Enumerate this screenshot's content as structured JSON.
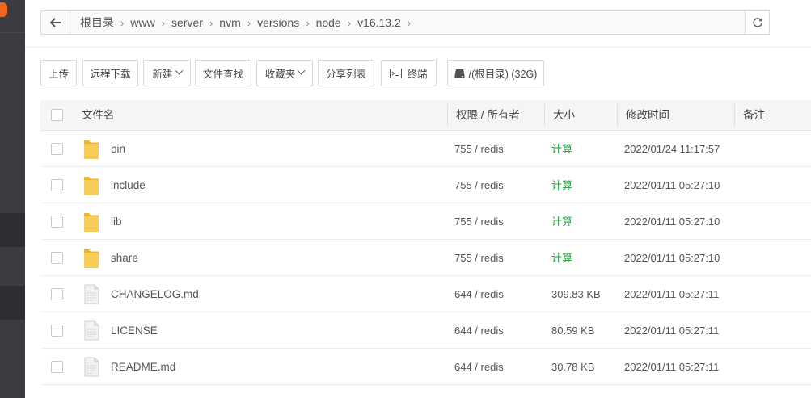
{
  "path_bar": {
    "crumbs": [
      "根目录",
      "www",
      "server",
      "nvm",
      "versions",
      "node",
      "v16.13.2"
    ]
  },
  "toolbar": {
    "upload": "上传",
    "remote_download": "远程下载",
    "new": "新建",
    "file_search": "文件查找",
    "favorites": "收藏夹",
    "share_list": "分享列表",
    "terminal": "终端",
    "disk": "/(根目录) (32G)"
  },
  "table": {
    "headers": {
      "name": "文件名",
      "perm_owner": "权限 / 所有者",
      "size": "大小",
      "mtime": "修改时间",
      "note": "备注"
    },
    "rows": [
      {
        "type": "folder",
        "name": "bin",
        "perm": "755 / redis",
        "size": "计算",
        "mtime": "2022/01/24 11:17:57"
      },
      {
        "type": "folder",
        "name": "include",
        "perm": "755 / redis",
        "size": "计算",
        "mtime": "2022/01/11 05:27:10"
      },
      {
        "type": "folder",
        "name": "lib",
        "perm": "755 / redis",
        "size": "计算",
        "mtime": "2022/01/11 05:27:10"
      },
      {
        "type": "folder",
        "name": "share",
        "perm": "755 / redis",
        "size": "计算",
        "mtime": "2022/01/11 05:27:10"
      },
      {
        "type": "file",
        "name": "CHANGELOG.md",
        "perm": "644 / redis",
        "size": "309.83 KB",
        "mtime": "2022/01/11 05:27:11"
      },
      {
        "type": "file",
        "name": "LICENSE",
        "perm": "644 / redis",
        "size": "80.59 KB",
        "mtime": "2022/01/11 05:27:11"
      },
      {
        "type": "file",
        "name": "README.md",
        "perm": "644 / redis",
        "size": "30.78 KB",
        "mtime": "2022/01/11 05:27:11"
      }
    ]
  },
  "colors": {
    "accent_green": "#20a53a",
    "sidebar": "#3a3c41",
    "folder_yellow": "#f5c242"
  }
}
